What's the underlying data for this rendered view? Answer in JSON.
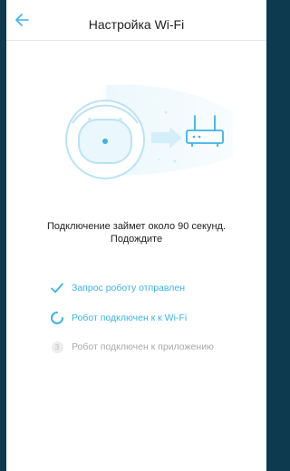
{
  "header": {
    "title": "Настройка Wi-Fi",
    "back_icon": "arrow-left-icon"
  },
  "message": "Подключение займет около 90 секунд. Подождите",
  "colors": {
    "accent": "#3ab4e6",
    "pending_text": "#a8a8a8",
    "frame": "#0d3a4e"
  },
  "steps": [
    {
      "label": "Запрос роботу отправлен",
      "status": "done",
      "icon": "checkmark-icon"
    },
    {
      "label": "Робот подключен к к Wi-Fi",
      "status": "in-progress",
      "icon": "spinner-icon"
    },
    {
      "label": "Робот подключен к приложению",
      "status": "pending",
      "number": "3"
    }
  ]
}
